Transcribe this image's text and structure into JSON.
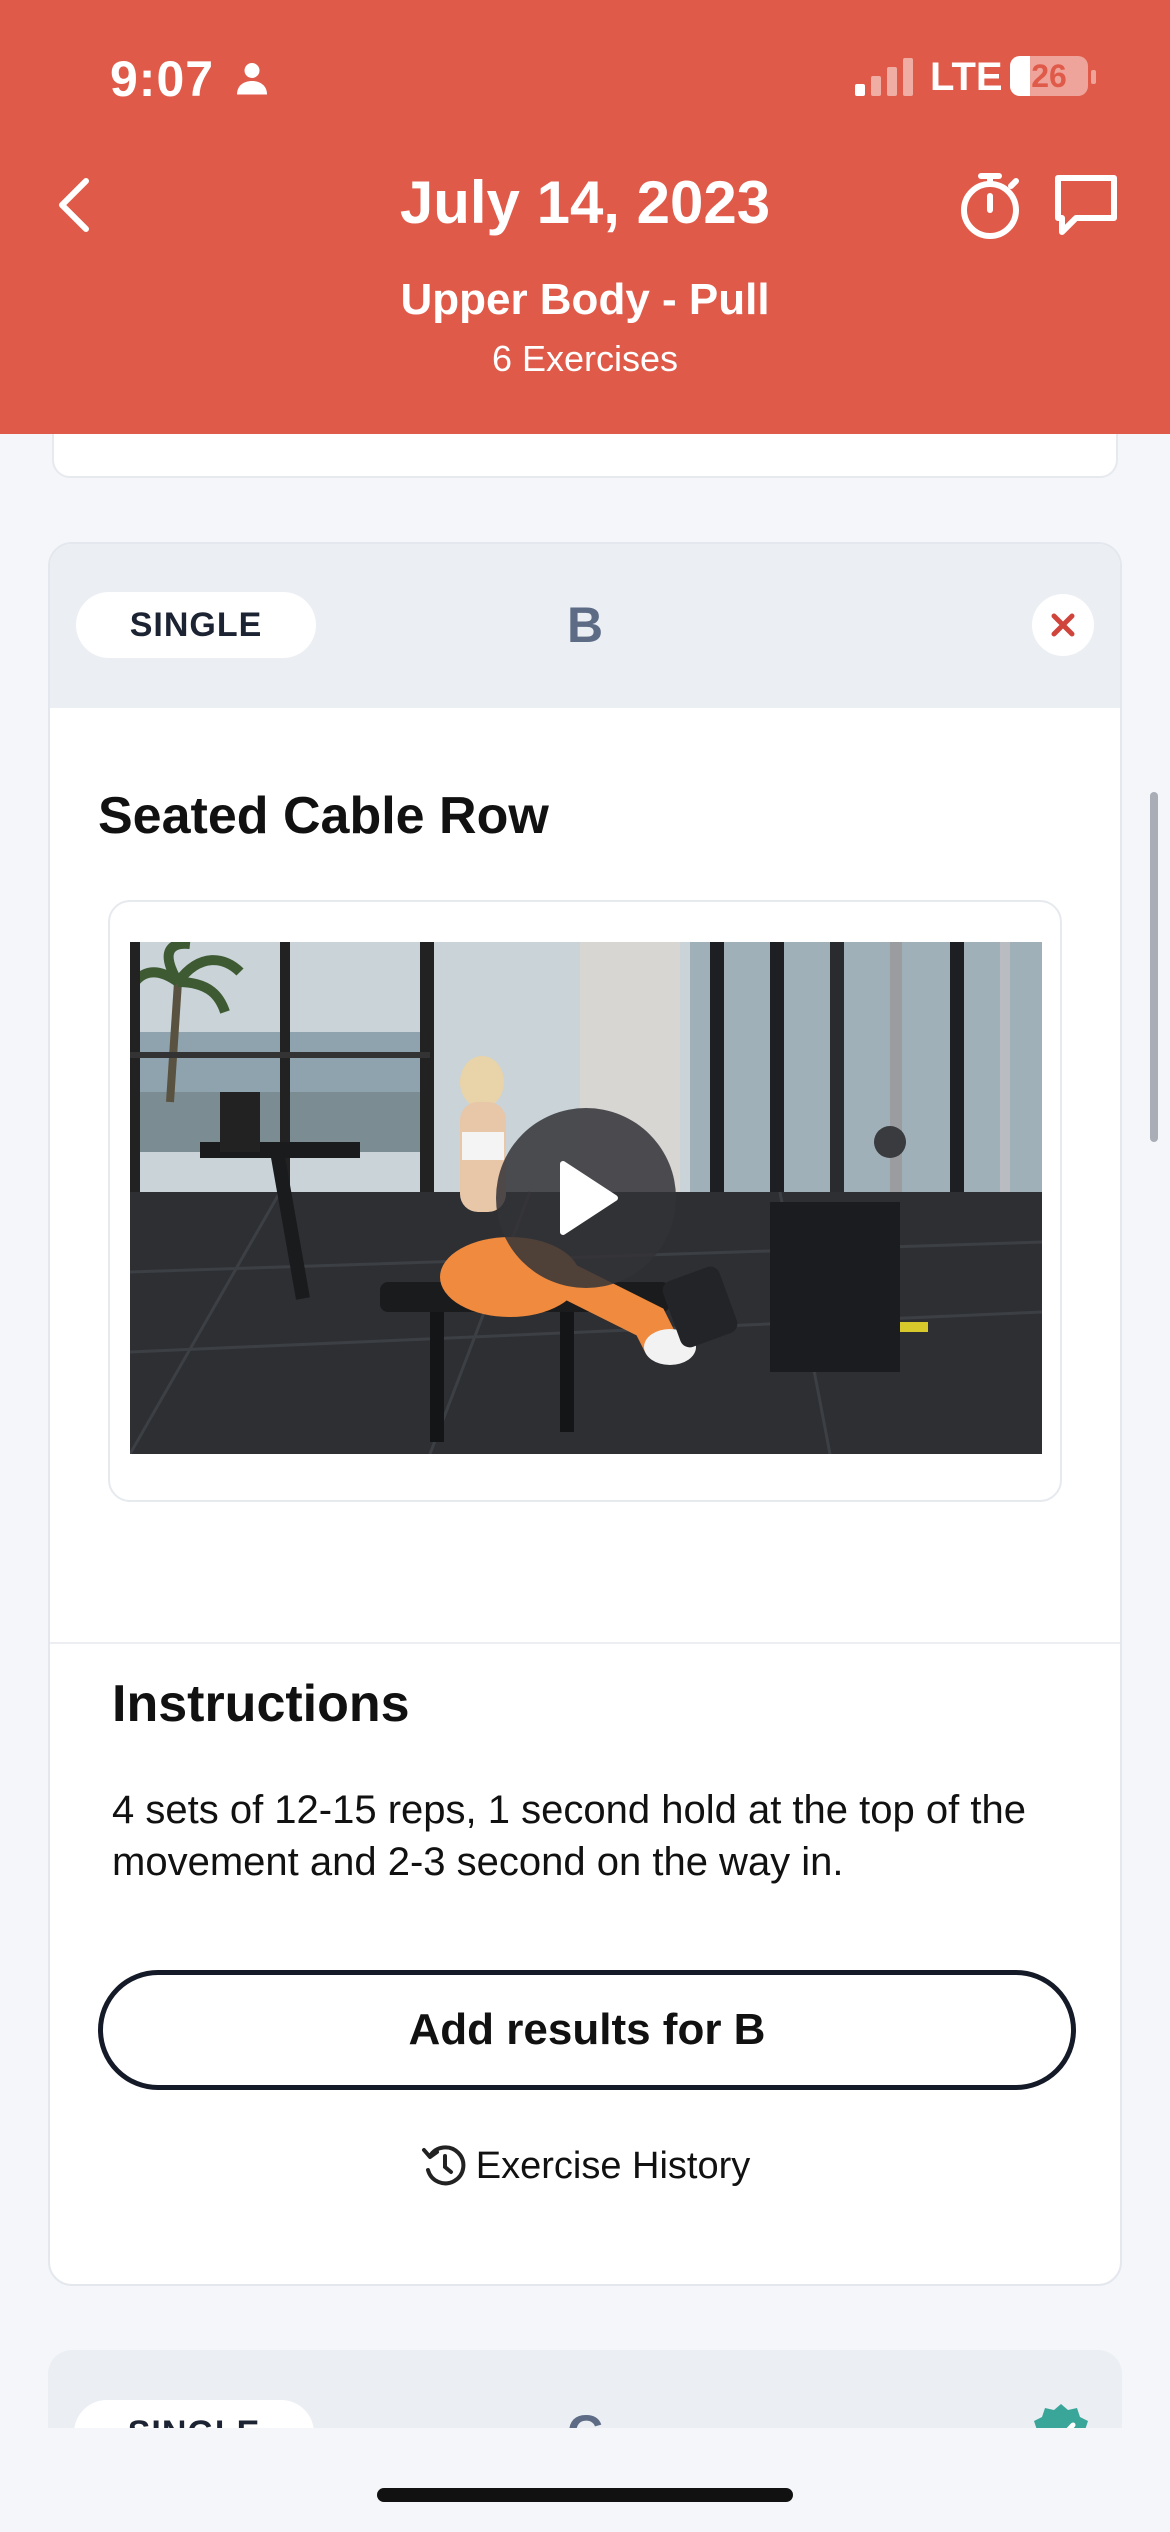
{
  "status_bar": {
    "time": "9:07",
    "network": "LTE",
    "battery": "26",
    "battery_level": 0.26
  },
  "header": {
    "date": "July 14, 2023",
    "workout_name": "Upper Body - Pull",
    "exercise_count": "6 Exercises",
    "back_icon": "chevron-left-icon",
    "timer_icon": "stopwatch-icon",
    "chat_icon": "chat-bubble-icon",
    "color": "#e05a49"
  },
  "exercise": {
    "type_label": "SINGLE",
    "letter": "B",
    "title": "Seated Cable Row",
    "video_label": "Seated Cable Row video",
    "instructions_title": "Instructions",
    "instructions_text": "4 sets of 12-15 reps, 1 second hold at the top of the movement and 2-3 second on the way in.",
    "add_results_label": "Add results for B",
    "history_label": "Exercise History"
  },
  "next_exercise": {
    "type_label": "SINGLE",
    "letter": "C",
    "status_icon": "check-badge-icon"
  }
}
